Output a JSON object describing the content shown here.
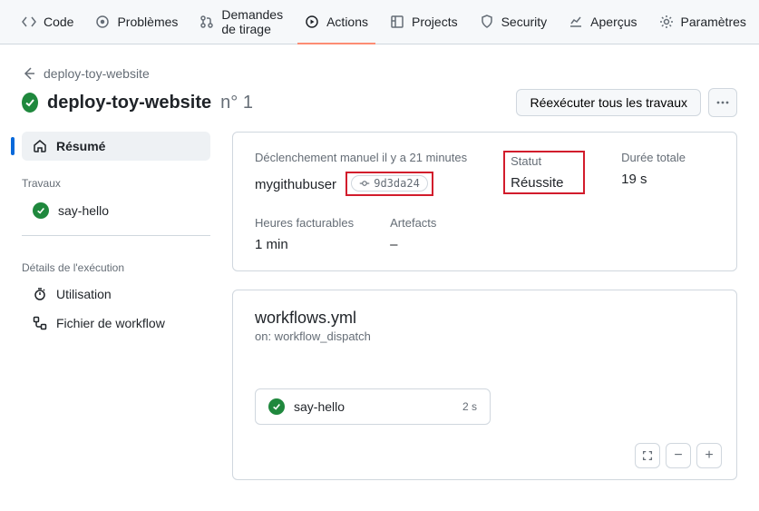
{
  "tabs": {
    "code": "Code",
    "issues": "Problèmes",
    "pulls": "Demandes de tirage",
    "actions": "Actions",
    "projects": "Projects",
    "security": "Security",
    "insights": "Aperçus",
    "settings": "Paramètres"
  },
  "breadcrumb": {
    "parent": "deploy-toy-website"
  },
  "title": {
    "name": "deploy-toy-website",
    "run_number": "n° 1"
  },
  "actions": {
    "rerun": "Réexécuter tous les travaux"
  },
  "sidebar": {
    "summary": "Résumé",
    "jobs_heading": "Travaux",
    "jobs": [
      {
        "name": "say-hello",
        "status": "success"
      }
    ],
    "details_heading": "Détails de l'exécution",
    "usage": "Utilisation",
    "workflow_file": "Fichier de workflow"
  },
  "summary": {
    "trigger_label": "Déclenchement manuel il y a 21 minutes",
    "actor": "mygithubuser",
    "sha": "9d3da24",
    "status_label": "Statut",
    "status_value": "Réussite",
    "duration_label": "Durée totale",
    "duration_value": "19 s",
    "billable_label": "Heures facturables",
    "billable_value": "1 min",
    "artifacts_label": "Artefacts",
    "artifacts_value": "–"
  },
  "workflow": {
    "filename": "workflows.yml",
    "trigger": "on: workflow_dispatch",
    "job_name": "say-hello",
    "job_time": "2 s"
  }
}
